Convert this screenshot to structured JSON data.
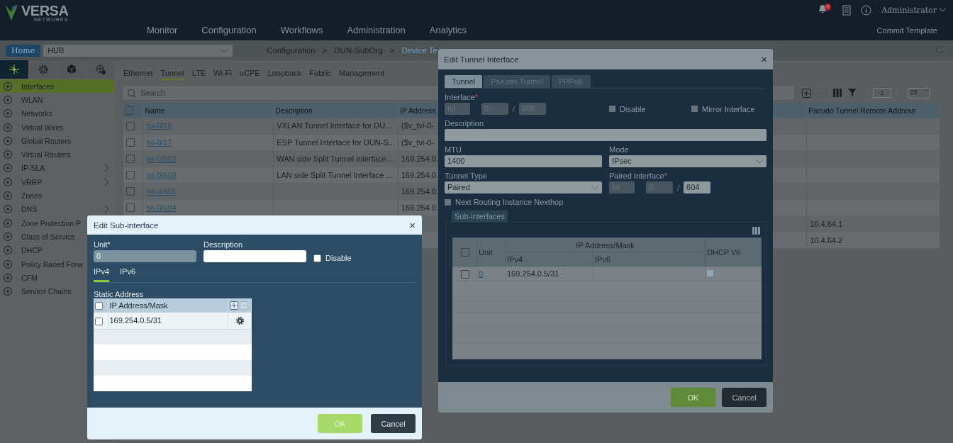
{
  "header": {
    "logo": "VERSA",
    "logo_sub": "NETWORKS",
    "nav": [
      {
        "label": "Monitor",
        "selected": false
      },
      {
        "label": "Configuration",
        "selected": false
      },
      {
        "label": "Workflows",
        "selected": false
      },
      {
        "label": "Administration",
        "selected": false
      },
      {
        "label": "Analytics",
        "selected": false
      }
    ],
    "notifications": "0",
    "user": "Administrator",
    "commit": "Commit Template"
  },
  "breadcrumb_bar": {
    "home": "Home",
    "org": "HUB",
    "crumbs": [
      {
        "label": "Configuration",
        "kind": "crumb"
      },
      {
        "label": ">",
        "kind": "sep"
      },
      {
        "label": "DUN-SubOrg",
        "kind": "crumb"
      },
      {
        "label": ">",
        "kind": "sep"
      },
      {
        "label": "Device Te",
        "kind": "current"
      }
    ]
  },
  "sidebar": {
    "tabs": [
      {
        "selected": true
      },
      {
        "selected": false
      },
      {
        "selected": false
      },
      {
        "selected": false
      }
    ],
    "items": [
      {
        "label": "Interfaces",
        "selected": true,
        "expandable": false
      },
      {
        "label": "WLAN",
        "selected": false,
        "expandable": false
      },
      {
        "label": "Networks",
        "selected": false,
        "expandable": false
      },
      {
        "label": "Virtual Wires",
        "selected": false,
        "expandable": false
      },
      {
        "label": "Global Routers",
        "selected": false,
        "expandable": false
      },
      {
        "label": "Virtual Routers",
        "selected": false,
        "expandable": false
      },
      {
        "label": "IP-SLA",
        "selected": false,
        "expandable": true
      },
      {
        "label": "VRRP",
        "selected": false,
        "expandable": true
      },
      {
        "label": "Zones",
        "selected": false,
        "expandable": false
      },
      {
        "label": "DNS",
        "selected": false,
        "expandable": true
      },
      {
        "label": "Zone Protection P",
        "selected": false
      },
      {
        "label": "Class of Service",
        "selected": false
      },
      {
        "label": "DHCP",
        "selected": false
      },
      {
        "label": "Policy Based Forw",
        "selected": false
      },
      {
        "label": "CFM",
        "selected": false
      },
      {
        "label": "Service Chains",
        "selected": false
      }
    ]
  },
  "content": {
    "tabs": [
      {
        "label": "Ethernet",
        "selected": false
      },
      {
        "label": "Tunnel",
        "selected": true
      },
      {
        "label": "LTE",
        "selected": false
      },
      {
        "label": "Wi-Fi",
        "selected": false
      },
      {
        "label": "uCPE",
        "selected": false
      },
      {
        "label": "Loopback",
        "selected": false
      },
      {
        "label": "Fabric",
        "selected": false
      },
      {
        "label": "Management",
        "selected": false
      }
    ],
    "search": {
      "placeholder": "Search"
    },
    "pager": {
      "page": "1",
      "size": "25"
    },
    "table": {
      "select_all": false,
      "columns": [
        "Name",
        "Description",
        "IP Address",
        "Pseudo Tunnel Remote Address"
      ],
      "rows": [
        {
          "checked": false,
          "name": "tvi-0/16",
          "description": "VXLAN Tunnel Interface for DU...",
          "ip": "($v_tvi-0-",
          "pseudo": ""
        },
        {
          "checked": false,
          "name": "tvi-0/17",
          "description": "ESP Tunnel Interface for DUN-S...",
          "ip": "($v_tvi-0-",
          "pseudo": ""
        },
        {
          "checked": false,
          "name": "tvi-0/602",
          "description": "WAN side Split Tunnel interface...",
          "ip": "169.254.0.",
          "pseudo": ""
        },
        {
          "checked": false,
          "name": "tvi-0/603",
          "description": "LAN side Split Tunnel Interface ...",
          "ip": "169.254.0.",
          "pseudo": ""
        },
        {
          "checked": false,
          "name": "tvi-0/605",
          "description": "",
          "ip": "169.254.0.",
          "pseudo": ""
        },
        {
          "checked": false,
          "name": "tvi-0/604",
          "description": "",
          "ip": "169.254.0.",
          "pseudo": ""
        },
        {
          "name": "",
          "description": "",
          "ip": "",
          "pseudo": "10.4.64.1"
        },
        {
          "name": "",
          "description": "",
          "ip": "",
          "pseudo": "10.4.64.2"
        }
      ]
    }
  },
  "tunnel_dialog": {
    "title": "Edit Tunnel Interface",
    "close": "×",
    "tabs": [
      {
        "label": "Tunnel",
        "selected": true
      },
      {
        "label": "Pseudo Tunnel",
        "selected": false
      },
      {
        "label": "PPPoE",
        "selected": false
      }
    ],
    "interface_label": "Interface",
    "interface_required": "*",
    "interface": [
      "tvi",
      "0",
      "605"
    ],
    "interface_separator": "/",
    "disable": {
      "label": "Disable",
      "checked": false
    },
    "mirror": {
      "label": "Mirror Interface",
      "checked": false
    },
    "description_label": "Description",
    "mtu_label": "MTU",
    "mtu": "1400",
    "mode_label": "Mode",
    "mode": "IPsec",
    "tunnel_type_label": "Tunnel Type",
    "tunnel_type": "Paired",
    "paired_label": "Paired Interface",
    "paired_required": "*",
    "paired": [
      "tvi",
      "0",
      "604"
    ],
    "paired_separator": "/",
    "nexthop": {
      "label": "Next Routing Instance Nexthop",
      "checked": false
    },
    "subinterfaces_label": "Sub-interfaces",
    "sub_table": {
      "select_all": false,
      "group": "IP Address/Mask",
      "columns": [
        "Unit",
        "IPv4",
        "IPv6",
        "DHCP V6"
      ],
      "rows": [
        {
          "checked": false,
          "unit": "0",
          "ipv4": "169.254.0.5/31",
          "ipv6": "",
          "dhcp": false
        }
      ]
    },
    "ok": "OK",
    "cancel": "Cancel"
  },
  "sub_dialog": {
    "title": "Edit Sub-interface",
    "close": "×",
    "unit_label": "Unit",
    "unit_required": "*",
    "unit": "0",
    "description_label": "Description",
    "disable": {
      "label": "Disable",
      "checked": false
    },
    "tabs": [
      {
        "label": "IPv4",
        "selected": true
      },
      {
        "label": "IPv6",
        "selected": false
      }
    ],
    "static_label": "Static Address",
    "select_all": false,
    "column": "IP Address/Mask",
    "rows": [
      {
        "address": "169.254.0.5/31",
        "checked": false
      }
    ],
    "ok": "OK",
    "cancel": "Cancel"
  }
}
